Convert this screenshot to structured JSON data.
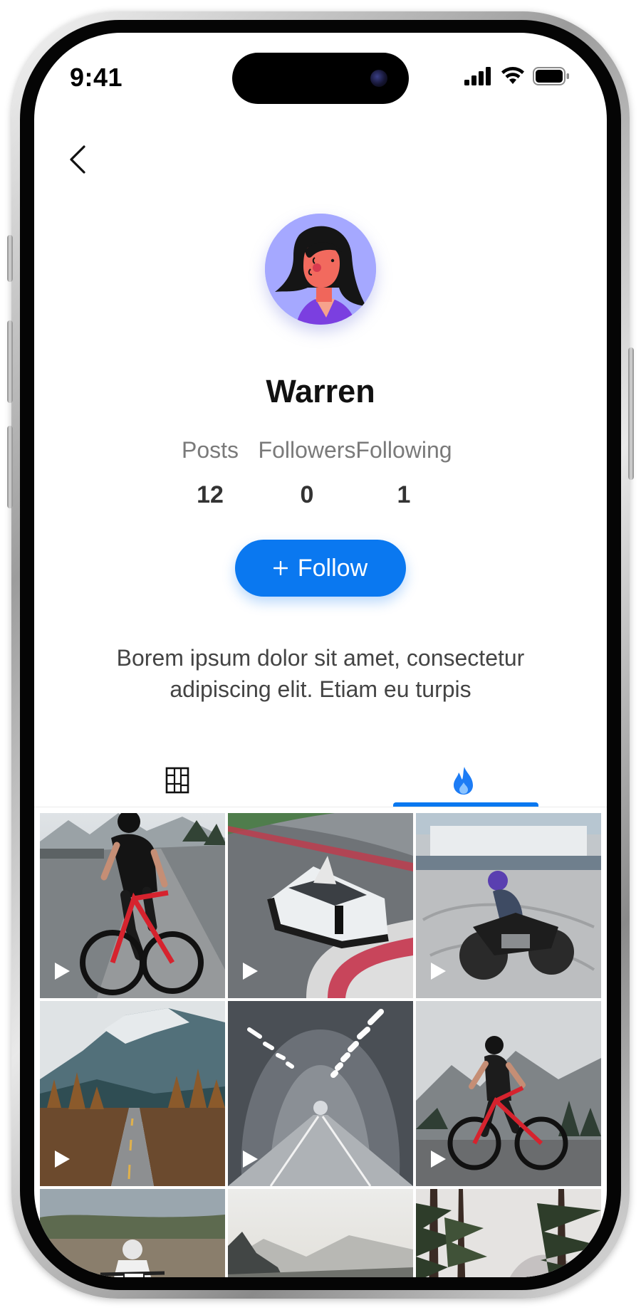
{
  "status_bar": {
    "time": "9:41",
    "icons": [
      "signal-icon",
      "wifi-icon",
      "battery-icon"
    ]
  },
  "nav": {
    "back_icon": "chevron-left-icon"
  },
  "profile": {
    "name": "Warren",
    "avatar": "avatar-illustration",
    "stats": [
      {
        "label": "Posts",
        "value": "12"
      },
      {
        "label": "Followers",
        "value": "0"
      },
      {
        "label": "Following",
        "value": "1"
      }
    ],
    "follow_label": "Follow",
    "follow_icon": "plus-icon",
    "bio": "Borem ipsum dolor sit amet, consectetur adipiscing elit. Etiam eu turpis"
  },
  "tabs": [
    {
      "icon": "grid-layout-icon",
      "active": false
    },
    {
      "icon": "flame-icon",
      "active": true
    }
  ],
  "media_grid": [
    {
      "subject": "cyclist on road",
      "icon": "play-icon"
    },
    {
      "subject": "race car on track",
      "icon": "play-icon"
    },
    {
      "subject": "motorcycle drifting",
      "icon": "play-icon"
    },
    {
      "subject": "mountain road",
      "icon": "play-icon"
    },
    {
      "subject": "tunnel",
      "icon": "play-icon"
    },
    {
      "subject": "cyclist in mountains",
      "icon": "play-icon"
    },
    {
      "subject": "dirt bike rider",
      "icon": null
    },
    {
      "subject": "misty valley road",
      "icon": null
    },
    {
      "subject": "misty forest",
      "icon": null
    }
  ],
  "colors": {
    "accent": "#0a78f0",
    "avatar_bg": "#a5a8ff",
    "text_primary": "#111111",
    "text_secondary": "#7a7a7a"
  }
}
